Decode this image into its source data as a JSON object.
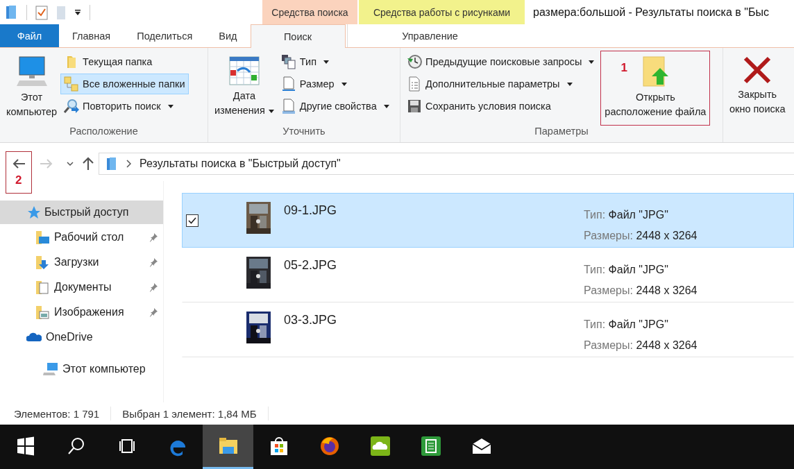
{
  "window": {
    "title": "размера:большой - Результаты поиска в \"Быс"
  },
  "contextual_tabs": [
    {
      "label": "Средства поиска",
      "color": "#fbd3bd"
    },
    {
      "label": "Средства работы с рисунками",
      "color": "#f2f28c"
    }
  ],
  "tabs": [
    {
      "label": "Файл",
      "kind": "file",
      "selected": false
    },
    {
      "label": "Главная",
      "kind": "normal",
      "selected": false
    },
    {
      "label": "Поделиться",
      "kind": "normal",
      "selected": false
    },
    {
      "label": "Вид",
      "kind": "normal",
      "selected": false
    },
    {
      "label": "Поиск",
      "kind": "normal",
      "selected": true
    },
    {
      "label": "Управление",
      "kind": "normal",
      "selected": false
    }
  ],
  "ribbon": {
    "groups": [
      {
        "label": "Расположение",
        "items": [
          {
            "kind": "large",
            "label": "Этот\nкомпьютер",
            "dropdown": false
          },
          {
            "kind": "small",
            "label": "Текущая папка",
            "selected": false,
            "dropdown": false
          },
          {
            "kind": "small",
            "label": "Все вложенные папки",
            "selected": true,
            "dropdown": false
          },
          {
            "kind": "small",
            "label": "Повторить поиск",
            "selected": false,
            "dropdown": true
          }
        ]
      },
      {
        "label": "Уточнить",
        "items": [
          {
            "kind": "large",
            "label": "Дата\nизменения",
            "dropdown": true
          },
          {
            "kind": "small",
            "label": "Тип",
            "selected": false,
            "dropdown": true
          },
          {
            "kind": "small",
            "label": "Размер",
            "selected": false,
            "dropdown": true
          },
          {
            "kind": "small",
            "label": "Другие свойства",
            "selected": false,
            "dropdown": true
          }
        ]
      },
      {
        "label": "Параметры",
        "items": [
          {
            "kind": "small",
            "label": "Предыдущие поисковые запросы",
            "selected": false,
            "dropdown": true
          },
          {
            "kind": "small",
            "label": "Дополнительные параметры",
            "selected": false,
            "dropdown": true
          },
          {
            "kind": "small",
            "label": "Сохранить условия поиска",
            "selected": false,
            "dropdown": false
          },
          {
            "kind": "large",
            "label": "Открыть\nрасположение файла",
            "dropdown": false,
            "annotation": "1"
          }
        ]
      },
      {
        "items": [
          {
            "kind": "large",
            "label": "Закрыть\nокно поиска",
            "dropdown": false
          }
        ]
      }
    ]
  },
  "navigation": {
    "back_disabled": false,
    "back_annotation": "2",
    "forward_disabled": true,
    "address": "Результаты поиска в \"Быстрый доступ\""
  },
  "sidebar": {
    "items": [
      {
        "label": "Быстрый доступ",
        "selected": true,
        "children": [
          {
            "label": "Рабочий стол",
            "pinned": true
          },
          {
            "label": "Загрузки",
            "pinned": true
          },
          {
            "label": "Документы",
            "pinned": true
          },
          {
            "label": "Изображения",
            "pinned": true
          }
        ]
      },
      {
        "label": "OneDrive",
        "selected": false
      },
      {
        "label": "Этот компьютер",
        "selected": false
      }
    ]
  },
  "results": [
    {
      "name": "09-1.JPG",
      "selected": true,
      "checked": true,
      "type_label": "Тип:",
      "type_value": "Файл \"JPG\"",
      "size_label": "Размеры:",
      "size_value": "2448 x 3264"
    },
    {
      "name": "05-2.JPG",
      "selected": false,
      "checked": false,
      "type_label": "Тип:",
      "type_value": "Файл \"JPG\"",
      "size_label": "Размеры:",
      "size_value": "2448 x 3264"
    },
    {
      "name": "03-3.JPG",
      "selected": false,
      "checked": false,
      "type_label": "Тип:",
      "type_value": "Файл \"JPG\"",
      "size_label": "Размеры:",
      "size_value": "2448 x 3264"
    }
  ],
  "status_bar": {
    "item_count": "Элементов: 1 791",
    "selection": "Выбран 1 элемент: 1,84 МБ"
  },
  "taskbar": {
    "items": [
      {
        "active": false
      },
      {
        "active": false
      },
      {
        "active": false
      },
      {
        "active": false
      },
      {
        "active": true
      },
      {
        "active": false
      },
      {
        "active": false
      },
      {
        "active": false
      },
      {
        "active": false
      },
      {
        "active": false
      }
    ]
  }
}
